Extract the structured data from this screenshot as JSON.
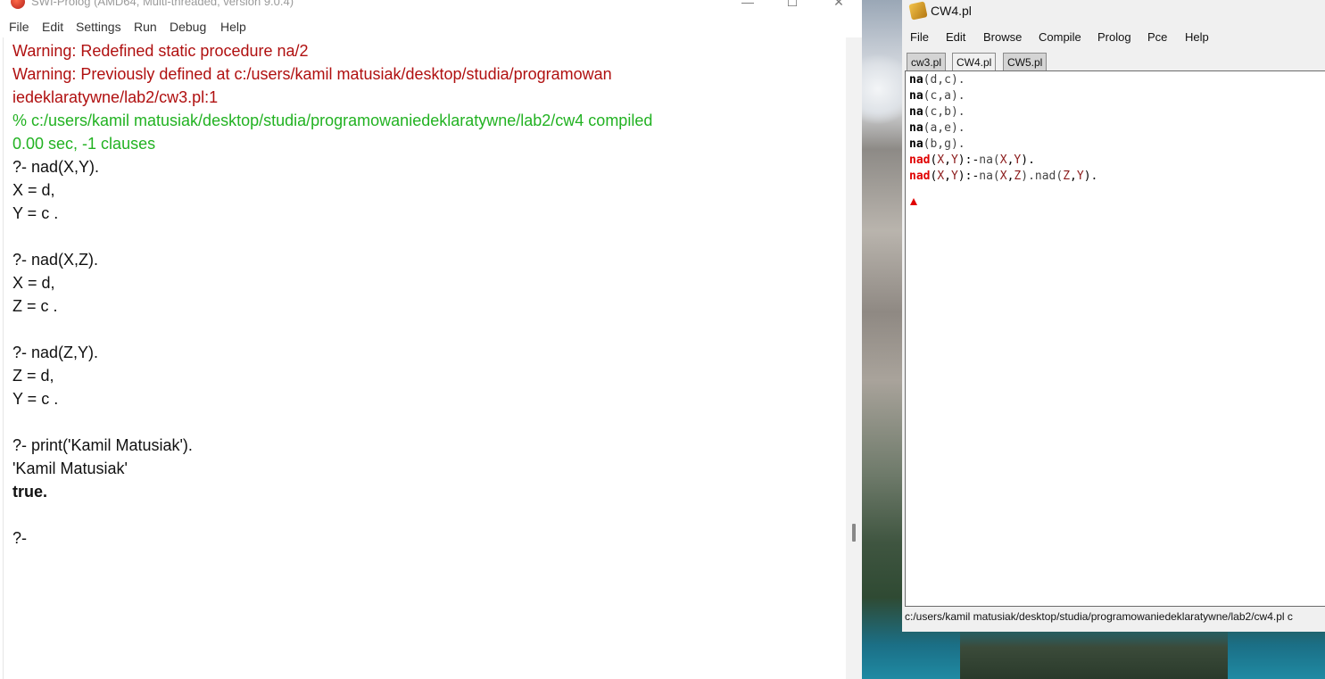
{
  "console": {
    "title": "SWI-Prolog (AMD64, Multi-threaded, version 9.0.4)",
    "controls": {
      "minimize": "—",
      "maximize": "☐",
      "close": "✕"
    },
    "menu": [
      "File",
      "Edit",
      "Settings",
      "Run",
      "Debug",
      "Help"
    ],
    "lines": [
      {
        "text": "Warning:    Redefined static procedure na/2",
        "style": "warn"
      },
      {
        "text": "Warning:    Previously defined at c:/users/kamil matusiak/desktop/studia/programowan",
        "style": "warn"
      },
      {
        "text": "iedeklaratywne/lab2/cw3.pl:1",
        "style": "warn"
      },
      {
        "text": "% c:/users/kamil matusiak/desktop/studia/programowaniedeklaratywne/lab2/cw4 compiled",
        "style": "ok"
      },
      {
        "text": " 0.00 sec, -1 clauses",
        "style": "ok"
      },
      {
        "text": "?- nad(X,Y).",
        "style": "norm"
      },
      {
        "text": "X = d,",
        "style": "norm"
      },
      {
        "text": "Y = c .",
        "style": "norm"
      },
      {
        "text": "",
        "style": "norm"
      },
      {
        "text": "?- nad(X,Z).",
        "style": "norm"
      },
      {
        "text": "X = d,",
        "style": "norm"
      },
      {
        "text": "Z = c .",
        "style": "norm"
      },
      {
        "text": "",
        "style": "norm"
      },
      {
        "text": "?- nad(Z,Y).",
        "style": "norm"
      },
      {
        "text": "Z = d,",
        "style": "norm"
      },
      {
        "text": "Y = c .",
        "style": "norm"
      },
      {
        "text": "",
        "style": "norm"
      },
      {
        "text": "?- print('Kamil Matusiak').",
        "style": "norm"
      },
      {
        "text": "'Kamil Matusiak'",
        "style": "norm"
      },
      {
        "text": "true.",
        "style": "bold"
      },
      {
        "text": "",
        "style": "norm"
      },
      {
        "text": "?-",
        "style": "norm"
      }
    ]
  },
  "editor": {
    "title": "CW4.pl",
    "menu": [
      "File",
      "Edit",
      "Browse",
      "Compile",
      "Prolog",
      "Pce",
      "Help"
    ],
    "tabs": [
      {
        "label": "cw3.pl",
        "active": false
      },
      {
        "label": "CW4.pl",
        "active": true
      },
      {
        "label": "CW5.pl",
        "active": false
      }
    ],
    "code": [
      [
        {
          "t": "na",
          "c": "kw"
        },
        {
          "t": "(d,c).",
          "c": "atom"
        }
      ],
      [
        {
          "t": "na",
          "c": "kw"
        },
        {
          "t": "(c,a).",
          "c": "atom"
        }
      ],
      [
        {
          "t": "na",
          "c": "kw"
        },
        {
          "t": "(c,b).",
          "c": "atom"
        }
      ],
      [
        {
          "t": "na",
          "c": "kw"
        },
        {
          "t": "(a,e).",
          "c": "atom"
        }
      ],
      [
        {
          "t": "na",
          "c": "kw"
        },
        {
          "t": "(b,g).",
          "c": "atom"
        }
      ],
      [
        {
          "t": "nad",
          "c": "kwred"
        },
        {
          "t": "(",
          "c": "punct"
        },
        {
          "t": "X",
          "c": "var"
        },
        {
          "t": ",",
          "c": "punct"
        },
        {
          "t": "Y",
          "c": "var"
        },
        {
          "t": "):-",
          "c": "punct"
        },
        {
          "t": "na(",
          "c": "atom"
        },
        {
          "t": "X",
          "c": "var"
        },
        {
          "t": ",",
          "c": "punct"
        },
        {
          "t": "Y",
          "c": "var"
        },
        {
          "t": ").",
          "c": "punct"
        }
      ],
      [
        {
          "t": "nad",
          "c": "kwred"
        },
        {
          "t": "(",
          "c": "punct"
        },
        {
          "t": "X",
          "c": "var"
        },
        {
          "t": ",",
          "c": "punct"
        },
        {
          "t": "Y",
          "c": "var"
        },
        {
          "t": "):-",
          "c": "punct"
        },
        {
          "t": "na(",
          "c": "atom"
        },
        {
          "t": "X",
          "c": "var"
        },
        {
          "t": ",",
          "c": "punct"
        },
        {
          "t": "Z",
          "c": "var"
        },
        {
          "t": ").nad(",
          "c": "atom"
        },
        {
          "t": "Z",
          "c": "var"
        },
        {
          "t": ",",
          "c": "punct"
        },
        {
          "t": "Y",
          "c": "var"
        },
        {
          "t": ").",
          "c": "punct"
        }
      ]
    ],
    "status": "c:/users/kamil matusiak/desktop/studia/programowaniedeklaratywne/lab2/cw4.pl c"
  }
}
